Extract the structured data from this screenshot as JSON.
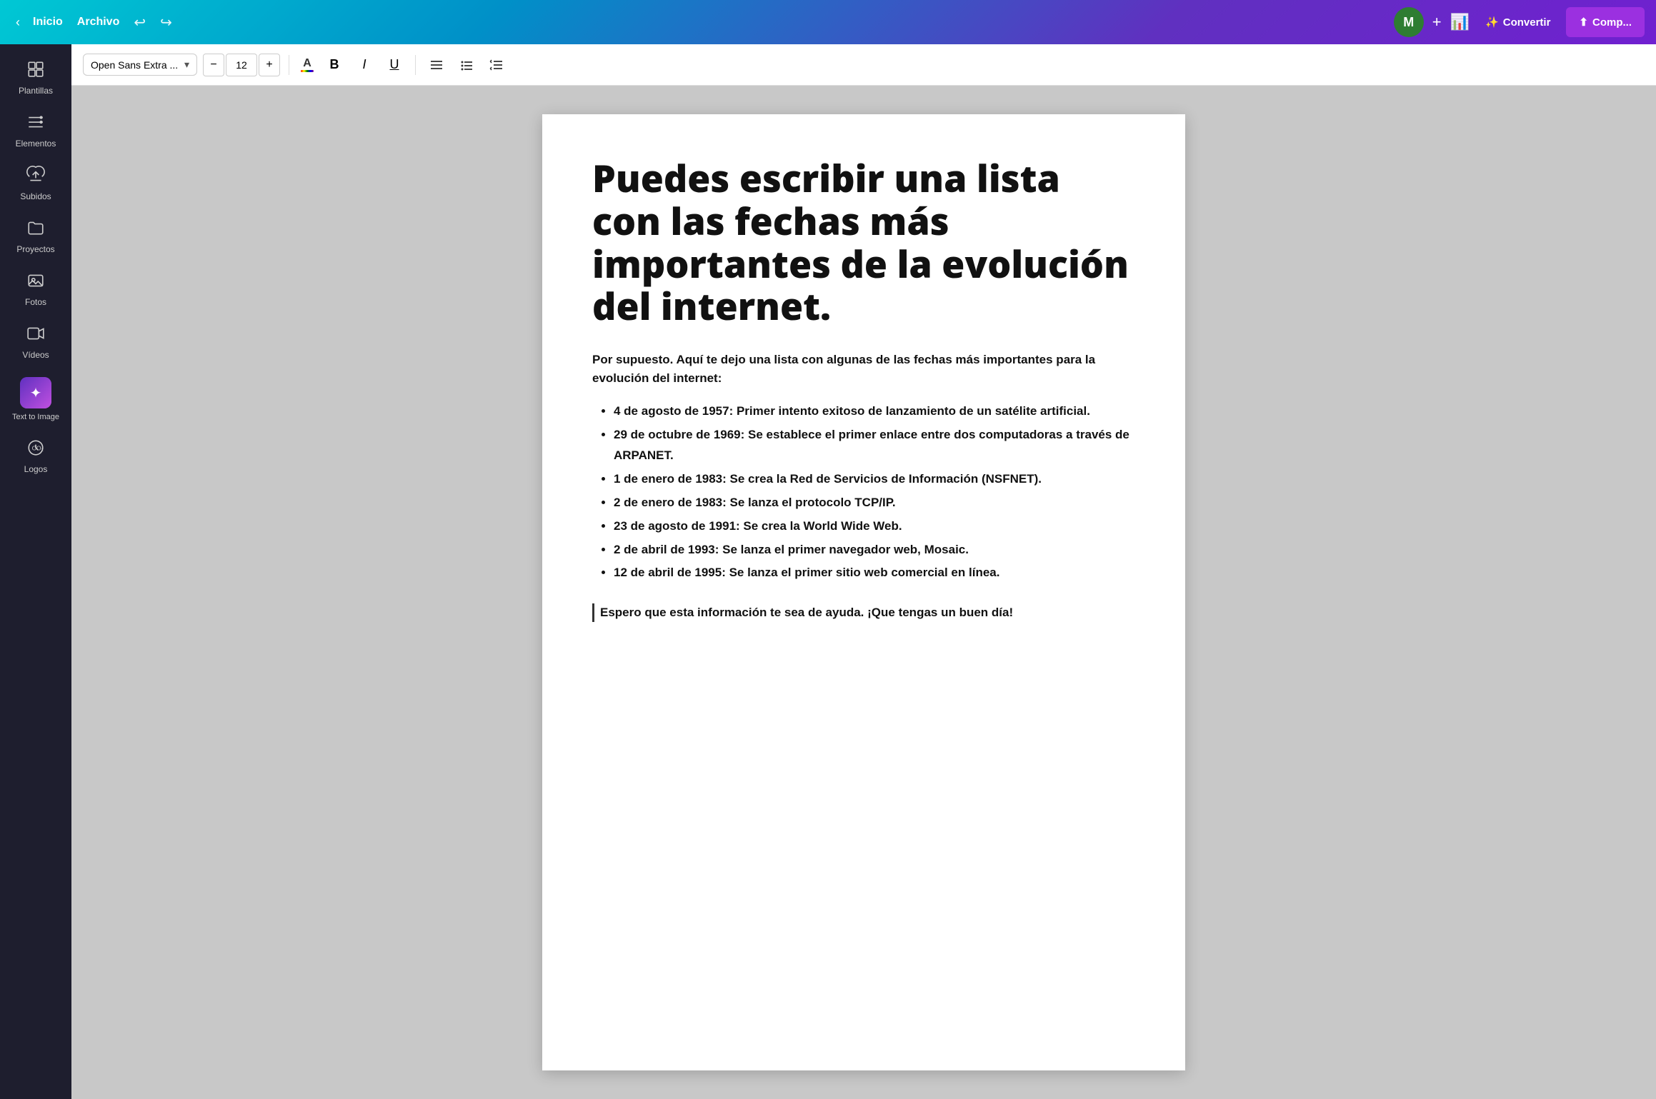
{
  "topbar": {
    "inicio_label": "Inicio",
    "archivo_label": "Archivo",
    "convertir_label": "Convertir",
    "compartir_label": "Comp...",
    "avatar_letter": "M"
  },
  "toolbar": {
    "font_family": "Open Sans Extra ...",
    "font_size": "12",
    "bold_label": "B",
    "italic_label": "I",
    "underline_label": "U"
  },
  "sidebar": {
    "items": [
      {
        "id": "plantillas",
        "label": "Plantillas",
        "icon": "⊞"
      },
      {
        "id": "elementos",
        "label": "Elementos",
        "icon": "❖"
      },
      {
        "id": "subidos",
        "label": "Subidos",
        "icon": "☁"
      },
      {
        "id": "proyectos",
        "label": "Proyectos",
        "icon": "📁"
      },
      {
        "id": "fotos",
        "label": "Fotos",
        "icon": "🖼"
      },
      {
        "id": "videos",
        "label": "Vídeos",
        "icon": "▶"
      },
      {
        "id": "text-to-image",
        "label": "Text to Image",
        "icon": "✦"
      },
      {
        "id": "logos",
        "label": "Logos",
        "icon": "©"
      }
    ]
  },
  "page": {
    "title": "Puedes escribir una lista con las fechas más importantes de la evolución del internet.",
    "intro": "Por supuesto. Aquí te dejo una lista con algunas de las fechas más importantes para la evolución del internet:",
    "list_items": [
      "4 de agosto de 1957: Primer intento exitoso de lanzamiento de un satélite artificial.",
      "29 de octubre de 1969: Se establece el primer enlace entre dos computadoras a través de ARPANET.",
      "1 de enero de 1983: Se crea la Red de Servicios de Información (NSFNET).",
      "2 de enero de 1983: Se lanza el protocolo TCP/IP.",
      "23 de agosto de 1991: Se crea la World Wide Web.",
      "2 de abril de 1993: Se lanza el primer navegador web, Mosaic.",
      "12 de abril de 1995: Se lanza el primer sitio web comercial en línea."
    ],
    "footer": "Espero que esta información te sea de ayuda. ¡Que tengas un buen día!"
  }
}
